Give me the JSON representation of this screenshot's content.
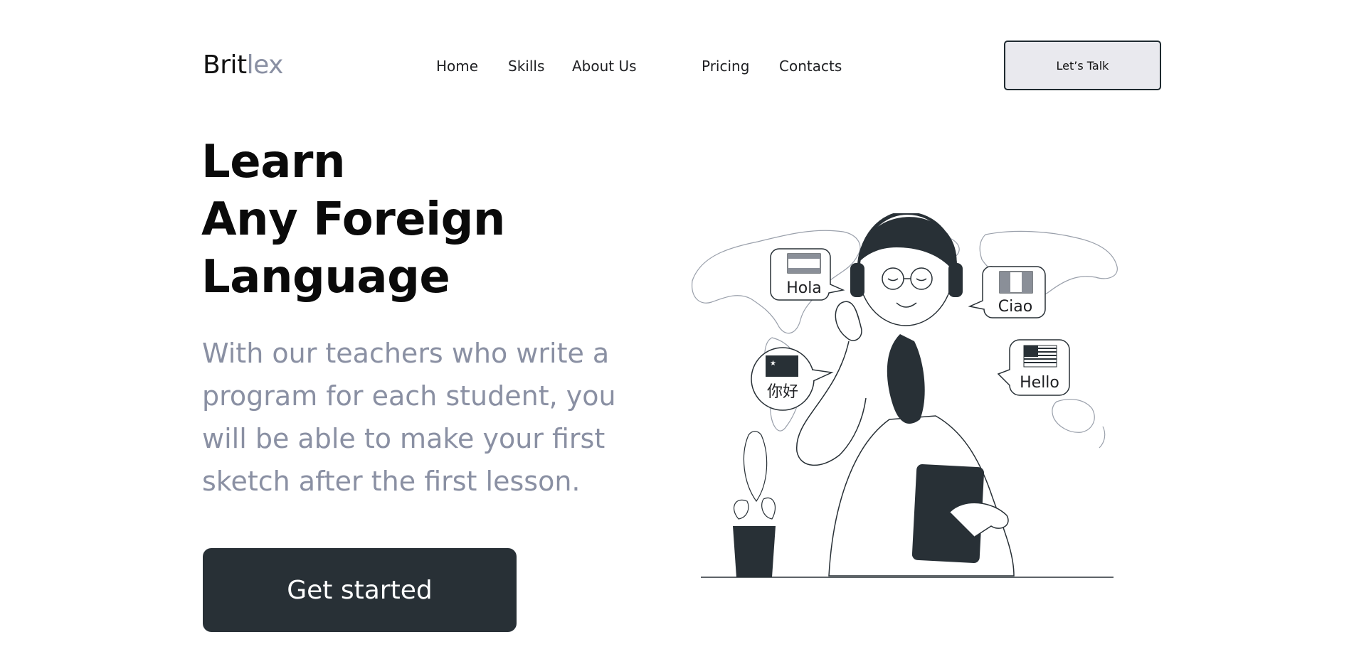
{
  "brand": {
    "part1": "Brit",
    "part2": "lex"
  },
  "nav": {
    "items": [
      {
        "label": "Home"
      },
      {
        "label": "Skills"
      },
      {
        "label": "About Us"
      },
      {
        "label": "Pricing"
      },
      {
        "label": "Contacts"
      }
    ]
  },
  "header": {
    "cta_label": "Let’s Talk"
  },
  "hero": {
    "title_lines": [
      "Learn",
      "Any Foreign",
      "Language"
    ],
    "description_lines": [
      "With our teachers who write a",
      "program for each student, you",
      "will be able to make your first",
      "sketch after the first lesson."
    ],
    "cta_label": "Get started"
  },
  "illustration": {
    "bubbles": {
      "spanish": "Hola",
      "italian": "Ciao",
      "chinese": "你好",
      "english": "Hello"
    }
  },
  "colors": {
    "brand_accent": "#8a90a3",
    "dark": "#283036",
    "button_light": "#e9e9ee",
    "text": "#111111"
  }
}
